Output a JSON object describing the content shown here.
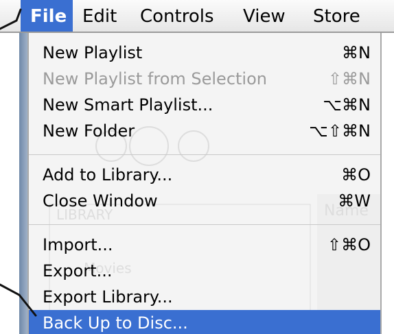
{
  "menubar": {
    "items": [
      "File",
      "Edit",
      "Controls",
      "View",
      "Store"
    ]
  },
  "menu": {
    "items": [
      {
        "label": "New Playlist",
        "shortcut": "⌘N",
        "enabled": true
      },
      {
        "label": "New Playlist from Selection",
        "shortcut": "⇧⌘N",
        "enabled": false
      },
      {
        "label": "New Smart Playlist...",
        "shortcut": "⌥⌘N",
        "enabled": true
      },
      {
        "label": "New Folder",
        "shortcut": "⌥⇧⌘N",
        "enabled": true
      },
      {
        "label": "Add to Library...",
        "shortcut": "⌘O",
        "enabled": true
      },
      {
        "label": "Close Window",
        "shortcut": "⌘W",
        "enabled": true
      },
      {
        "label": "Import...",
        "shortcut": "⇧⌘O",
        "enabled": true
      },
      {
        "label": "Export...",
        "shortcut": "",
        "enabled": true
      },
      {
        "label": "Export Library...",
        "shortcut": "",
        "enabled": true
      },
      {
        "label": "Back Up to Disc...",
        "shortcut": "",
        "enabled": true,
        "selected": true
      }
    ]
  },
  "colors": {
    "highlight": "#3a6fd1",
    "disabled_text": "#9a9a9a",
    "menu_bg": "#f4f4f4"
  },
  "background_ghost_text": [
    "LIBRARY",
    "Name",
    "Movies"
  ]
}
